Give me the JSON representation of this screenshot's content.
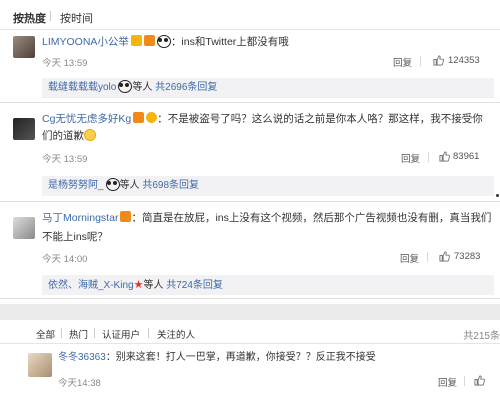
{
  "tabs": {
    "hot": "按热度",
    "time": "按时间"
  },
  "comments": [
    {
      "user": "LIMYOONA小公举",
      "text": "：ins和Twitter上都没有哦",
      "time": "今天 13:59",
      "reply_label": "回复",
      "likes": "124353",
      "replies": {
        "user": "载缝载载载yolo",
        "middle": "等人",
        "total": "共2696条回复"
      }
    },
    {
      "user": "Cg无忧无虑多好Kg",
      "text": "：不是被盗号了吗？这么说的话之前是你本人咯？那这样，我不接受你",
      "text2": "们的道歉",
      "time": "今天 13:59",
      "reply_label": "回复",
      "likes": "83961",
      "replies": {
        "user": "是杨努努阿_",
        "middle": "等人",
        "total": "共698条回复"
      }
    },
    {
      "user": "马丁Morningstar",
      "text": "：简直是在放屁，ins上没有这个视频，然后那个广告视频也没有删，真当我们",
      "text2": "不能上ins呢？",
      "time": "今天 14:00",
      "reply_label": "回复",
      "likes": "73283",
      "replies": {
        "user": "依然、海贼_X-King",
        "middle": "等人",
        "total": "共724条回复"
      }
    }
  ],
  "filters": {
    "all": "全部",
    "hot": "热门",
    "verified": "认证用户",
    "following": "关注的人",
    "count": "共215条"
  },
  "last_comment": {
    "user": "冬冬36363",
    "text": "：别来这套！打人一巴掌，再道歉，你接受？？反正我不接受",
    "time": "今天14:38",
    "reply_label": "回复"
  },
  "colors": {
    "link": "#3e69a8",
    "reply_bg": "#f2f2f5",
    "gap_bg": "#ececec"
  }
}
